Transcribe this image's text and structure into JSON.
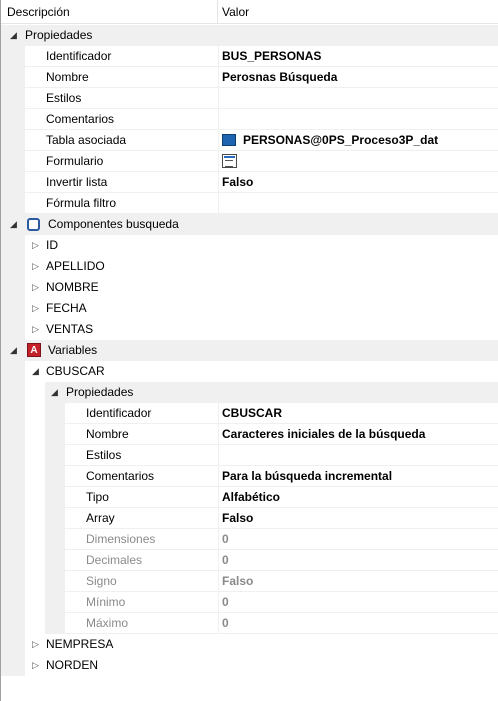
{
  "header": {
    "col_desc": "Descripción",
    "col_val": "Valor"
  },
  "icons": {
    "section_toggle": "triangle-down-icon",
    "collapsed_toggle": "triangle-right-icon",
    "component_icon": "component-icon",
    "variables_icon": "variables-icon",
    "table_icon": "table-icon",
    "form_icon": "form-icon"
  },
  "propiedades": {
    "label": "Propiedades",
    "identificador": {
      "label": "Identificador",
      "value": "BUS_PERSONAS"
    },
    "nombre": {
      "label": "Nombre",
      "value": "Perosnas Búsqueda"
    },
    "estilos": {
      "label": "Estilos",
      "value": ""
    },
    "comentarios": {
      "label": "Comentarios",
      "value": ""
    },
    "tabla": {
      "label": "Tabla asociada",
      "value": "PERSONAS@0PS_Proceso3P_dat"
    },
    "formulario": {
      "label": "Formulario",
      "value": ""
    },
    "invertir": {
      "label": "Invertir lista",
      "value": "Falso"
    },
    "formula": {
      "label": "Fórmula filtro",
      "value": ""
    }
  },
  "componentes": {
    "label": "Componentes busqueda",
    "items": [
      "ID",
      "APELLIDO",
      "NOMBRE",
      "FECHA",
      "VENTAS"
    ]
  },
  "variables": {
    "label": "Variables",
    "cbuscar": {
      "label": "CBUSCAR",
      "props_label": "Propiedades",
      "identificador": {
        "label": "Identificador",
        "value": "CBUSCAR"
      },
      "nombre": {
        "label": "Nombre",
        "value": "Caracteres iniciales de la búsqueda"
      },
      "estilos": {
        "label": "Estilos",
        "value": ""
      },
      "comentarios": {
        "label": "Comentarios",
        "value": "Para la búsqueda incremental"
      },
      "tipo": {
        "label": "Tipo",
        "value": "Alfabético"
      },
      "array": {
        "label": "Array",
        "value": "Falso"
      },
      "dimensiones": {
        "label": "Dimensiones",
        "value": "0"
      },
      "decimales": {
        "label": "Decimales",
        "value": "0"
      },
      "signo": {
        "label": "Signo",
        "value": "Falso"
      },
      "minimo": {
        "label": "Mínimo",
        "value": "0"
      },
      "maximo": {
        "label": "Máximo",
        "value": "0"
      }
    },
    "others": [
      "NEMPRESA",
      "NORDEN"
    ]
  }
}
